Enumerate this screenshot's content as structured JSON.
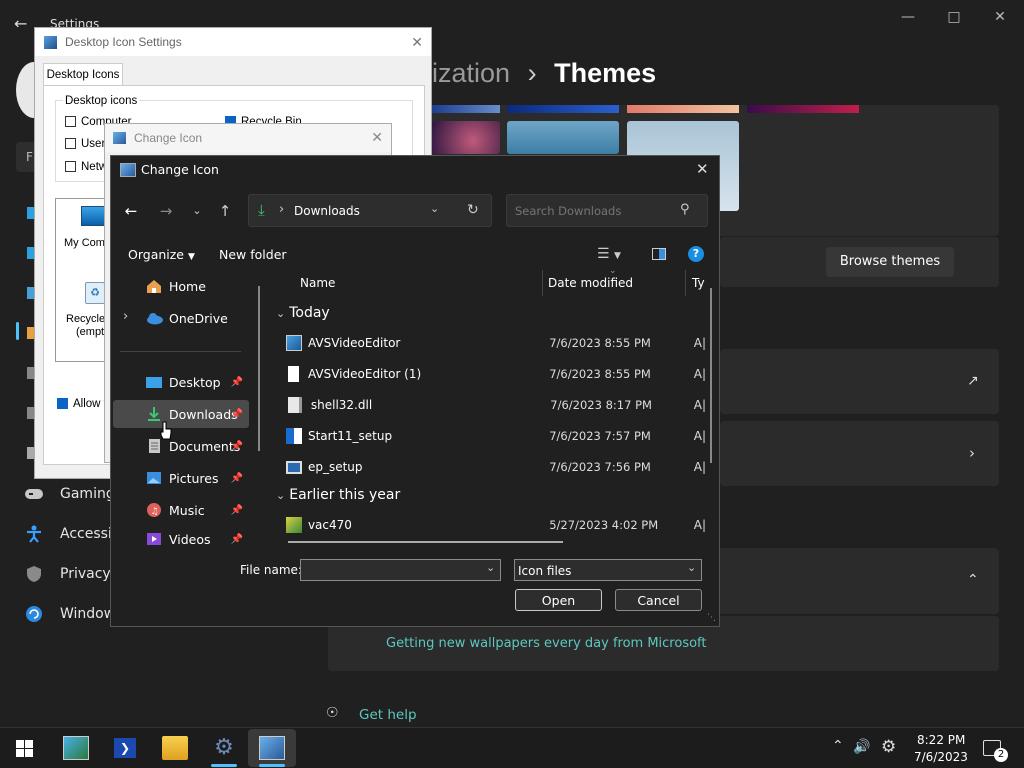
{
  "settings": {
    "window_title": "Settings",
    "breadcrumb_partial": "ization",
    "breadcrumb_sep": "›",
    "page_title": "Themes",
    "browse_themes_label": "Browse themes",
    "wallpaper_link": "Getting new wallpapers every day from Microsoft",
    "get_help": "Get help",
    "nav": [
      {
        "label": "Gaming"
      },
      {
        "label": "Accessib"
      },
      {
        "label": "Privacy c"
      },
      {
        "label": "Window"
      }
    ]
  },
  "desktop_icon_settings": {
    "title": "Desktop Icon Settings",
    "tab": "Desktop Icons",
    "group_label": "Desktop icons",
    "checks": [
      {
        "label": "Computer",
        "checked": false
      },
      {
        "label": "User",
        "checked": false
      },
      {
        "label": "Netw",
        "checked": false
      },
      {
        "label": "Recycle Bin",
        "checked": true
      }
    ],
    "icons": [
      {
        "label": "My Comp"
      },
      {
        "label": "Recycle"
      },
      {
        "label": "(empt"
      }
    ],
    "allow_label": "Allow t"
  },
  "change_icon_back": {
    "title": "Change Icon"
  },
  "dialog": {
    "title": "Change Icon",
    "address": "Downloads",
    "search_placeholder": "Search Downloads",
    "organize": "Organize",
    "new_folder": "New folder",
    "columns": {
      "name": "Name",
      "date": "Date modified",
      "type": "Ty"
    },
    "nav_pane": [
      {
        "label": "Home",
        "icon": "home-icon"
      },
      {
        "label": "OneDrive",
        "icon": "cloud-icon"
      },
      {
        "label": "Desktop",
        "icon": "desktop-folder-icon"
      },
      {
        "label": "Downloads",
        "icon": "download-icon"
      },
      {
        "label": "Documents",
        "icon": "document-icon"
      },
      {
        "label": "Pictures",
        "icon": "picture-icon"
      },
      {
        "label": "Music",
        "icon": "music-icon"
      },
      {
        "label": "Videos",
        "icon": "video-icon"
      }
    ],
    "groups": [
      {
        "label": "Today"
      },
      {
        "label": "Earlier this year"
      }
    ],
    "files": [
      {
        "name": "AVSVideoEditor",
        "date": "7/6/2023 8:55 PM",
        "type": "A|",
        "icon": "installer-icon"
      },
      {
        "name": "AVSVideoEditor (1)",
        "date": "7/6/2023 8:55 PM",
        "type": "A|",
        "icon": "file-icon"
      },
      {
        "name": "shell32.dll",
        "date": "7/6/2023 8:17 PM",
        "type": "A|",
        "icon": "dll-icon"
      },
      {
        "name": "Start11_setup",
        "date": "7/6/2023 7:57 PM",
        "type": "A|",
        "icon": "installer-icon"
      },
      {
        "name": "ep_setup",
        "date": "7/6/2023 7:56 PM",
        "type": "A|",
        "icon": "app-icon"
      },
      {
        "name": "vac470",
        "date": "5/27/2023 4:02 PM",
        "type": "A|",
        "icon": "app-icon"
      }
    ],
    "file_name_label": "File name:",
    "file_name_value": "",
    "file_type": "Icon files",
    "open": "Open",
    "cancel": "Cancel"
  },
  "taskbar": {
    "time": "8:22 PM",
    "date": "7/6/2023",
    "notification_count": "2"
  },
  "colors": {
    "accent": "#4cc2ff",
    "link": "#5cc8c0",
    "checkbox": "#0a64c8"
  }
}
